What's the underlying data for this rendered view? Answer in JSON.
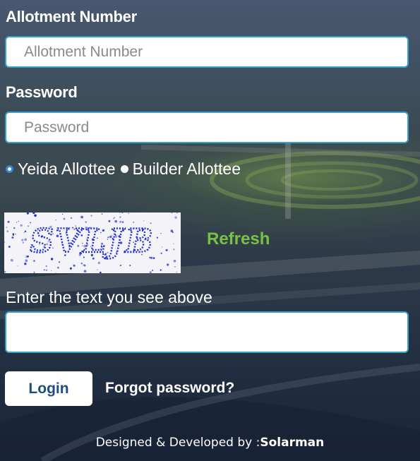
{
  "form": {
    "allotment_label": "Allotment Number",
    "allotment_placeholder": "Allotment Number",
    "password_label": "Password",
    "password_placeholder": "Password",
    "allottee_options": [
      {
        "label": "Yeida Allottee",
        "selected": true
      },
      {
        "label": "Builder Allottee",
        "selected": false
      }
    ],
    "captcha_text": "SVLJB",
    "refresh_label": "Refresh",
    "captcha_hint": "Enter the text you see above",
    "captcha_value": "",
    "login_label": "Login",
    "forgot_label": "Forgot password?"
  },
  "footer": {
    "prefix": "Designed & Developed by :",
    "company": "Solarman"
  },
  "colors": {
    "input_border": "#36a2c9",
    "refresh_green": "#7ac143",
    "login_text": "#1d4e7c",
    "radio_selected": "#3a83d8",
    "captcha_ink": "#1f2fd1"
  }
}
